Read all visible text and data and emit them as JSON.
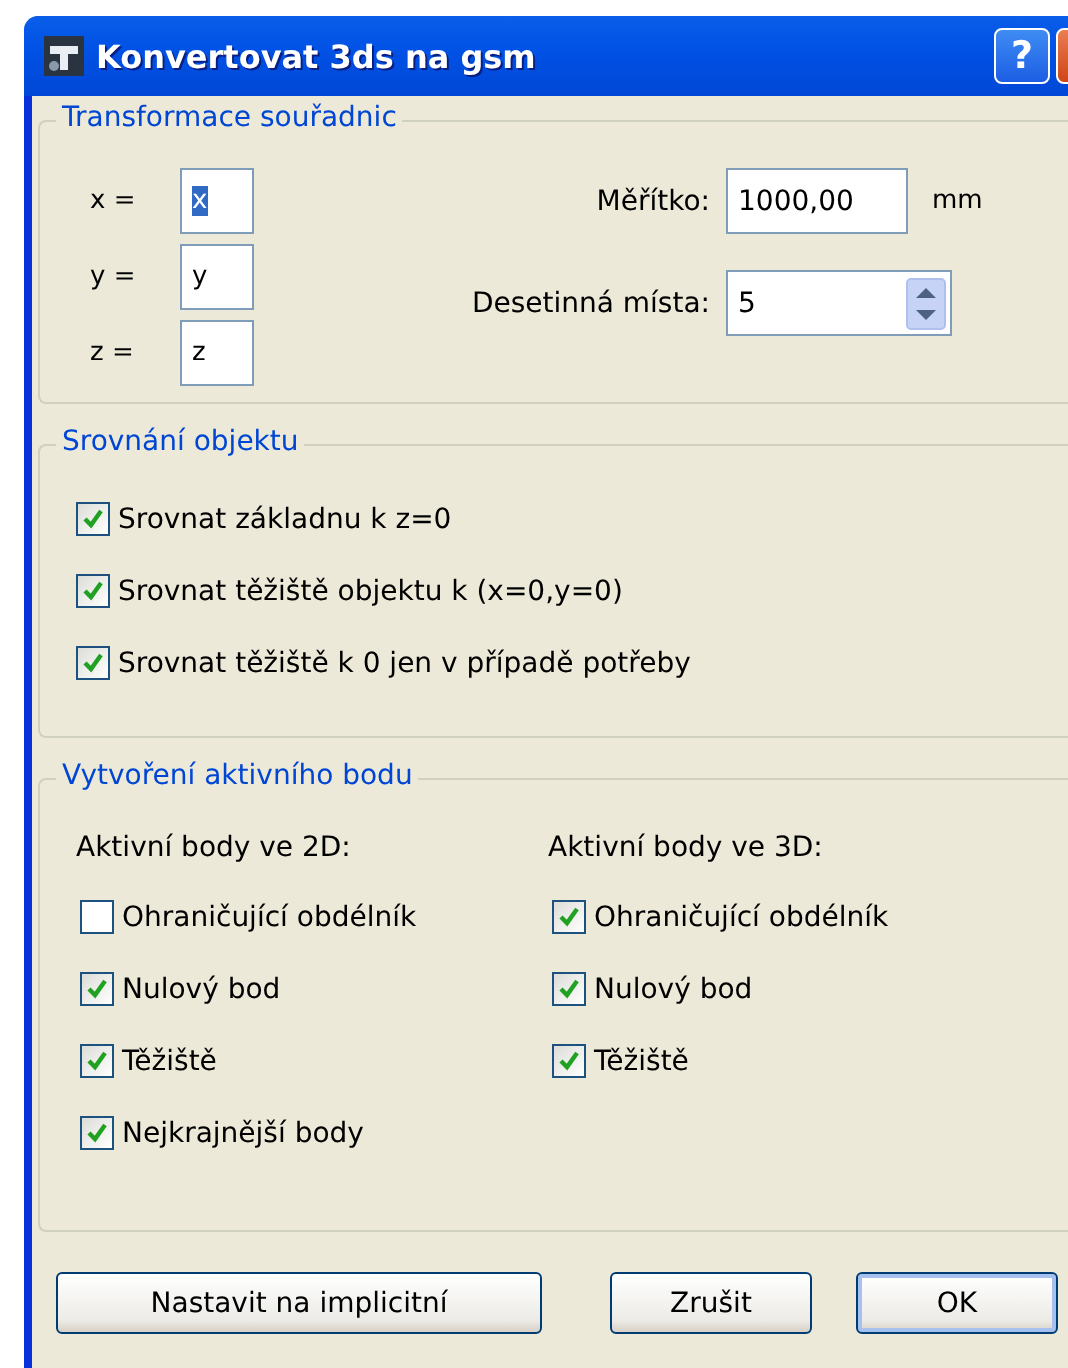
{
  "window": {
    "title": "Konvertovat 3ds na gsm",
    "title_buttons": [
      {
        "kind": "help",
        "label": "?"
      },
      {
        "kind": "close"
      }
    ]
  },
  "transform": {
    "title": "Transformace souřadnic",
    "coords": [
      {
        "label": "x =",
        "value": "x",
        "highlighted": true
      },
      {
        "label": "y =",
        "value": "y",
        "highlighted": false
      },
      {
        "label": "z =",
        "value": "z",
        "highlighted": false
      }
    ],
    "scale": {
      "label": "Měřítko:",
      "value": "1000,00",
      "unit": "mm"
    },
    "decimals": {
      "label": "Desetinná místa:",
      "value": "5"
    }
  },
  "alignment": {
    "title": "Srovnání objektu",
    "options": [
      {
        "label": "Srovnat základnu k z=0",
        "checked": true
      },
      {
        "label": "Srovnat těžiště objektu k (x=0,y=0)",
        "checked": true
      },
      {
        "label": "Srovnat těžiště k 0 jen v případě potřeby",
        "checked": true
      }
    ]
  },
  "hotspots": {
    "title": "Vytvoření aktivního bodu",
    "columns": [
      {
        "heading": "Aktivní body ve 2D:",
        "options": [
          {
            "label": "Ohraničující obdélník",
            "checked": false
          },
          {
            "label": "Nulový bod",
            "checked": true
          },
          {
            "label": "Těžiště",
            "checked": true
          },
          {
            "label": "Nejkrajnější body",
            "checked": true
          }
        ]
      },
      {
        "heading": "Aktivní body ve 3D:",
        "options": [
          {
            "label": "Ohraničující obdélník",
            "checked": true
          },
          {
            "label": "Nulový bod",
            "checked": true
          },
          {
            "label": "Těžiště",
            "checked": true
          }
        ]
      }
    ]
  },
  "buttons": [
    {
      "label": "Nastavit na implicitní",
      "kind": "wide",
      "default": false
    },
    {
      "label": "Zrušit",
      "kind": "normal",
      "default": false
    },
    {
      "label": "OK",
      "kind": "normal",
      "default": true
    }
  ]
}
